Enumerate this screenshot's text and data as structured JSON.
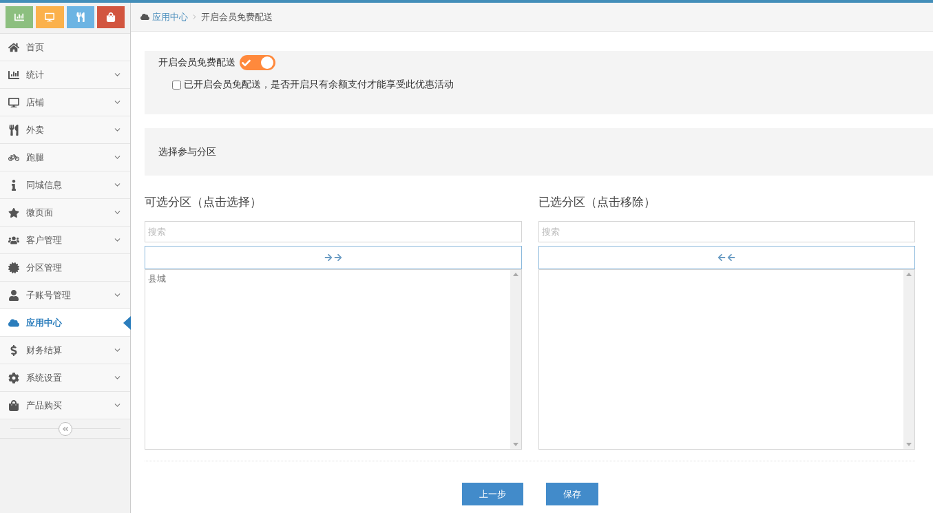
{
  "sidebar": {
    "quick_buttons": [
      {
        "color": "#8cbf7f"
      },
      {
        "color": "#fbb14b"
      },
      {
        "color": "#6cb4e3"
      },
      {
        "color": "#d2553f"
      }
    ],
    "items": [
      {
        "label": "首页",
        "has_submenu": false,
        "selected": false
      },
      {
        "label": "统计",
        "has_submenu": true,
        "selected": false
      },
      {
        "label": "店铺",
        "has_submenu": true,
        "selected": false
      },
      {
        "label": "外卖",
        "has_submenu": true,
        "selected": false
      },
      {
        "label": "跑腿",
        "has_submenu": true,
        "selected": false
      },
      {
        "label": "同城信息",
        "has_submenu": true,
        "selected": false
      },
      {
        "label": "微页面",
        "has_submenu": true,
        "selected": false
      },
      {
        "label": "客户管理",
        "has_submenu": true,
        "selected": false
      },
      {
        "label": "分区管理",
        "has_submenu": false,
        "selected": false
      },
      {
        "label": "子账号管理",
        "has_submenu": true,
        "selected": false
      },
      {
        "label": "应用中心",
        "has_submenu": false,
        "selected": true
      },
      {
        "label": "财务结算",
        "has_submenu": true,
        "selected": false
      },
      {
        "label": "系统设置",
        "has_submenu": true,
        "selected": false
      },
      {
        "label": "产品购买",
        "has_submenu": true,
        "selected": false
      }
    ]
  },
  "breadcrumb": [
    "应用中心",
    "开启会员免费配送"
  ],
  "free_delivery": {
    "label": "开启会员免费配送",
    "on": true,
    "balance_only": {
      "label": "已开启会员免配送，是否开启只有余额支付才能享受此优惠活动",
      "checked": false
    }
  },
  "zones": {
    "title": "选择参与分区",
    "available": {
      "title": "可选分区（点击选择）",
      "search": {
        "placeholder": "搜索"
      },
      "options": [
        "县城"
      ]
    },
    "chosen": {
      "title": "已选分区（点击移除）",
      "search": {
        "placeholder": "搜索"
      }
    }
  },
  "buttons": [
    "上一步",
    "保存"
  ]
}
